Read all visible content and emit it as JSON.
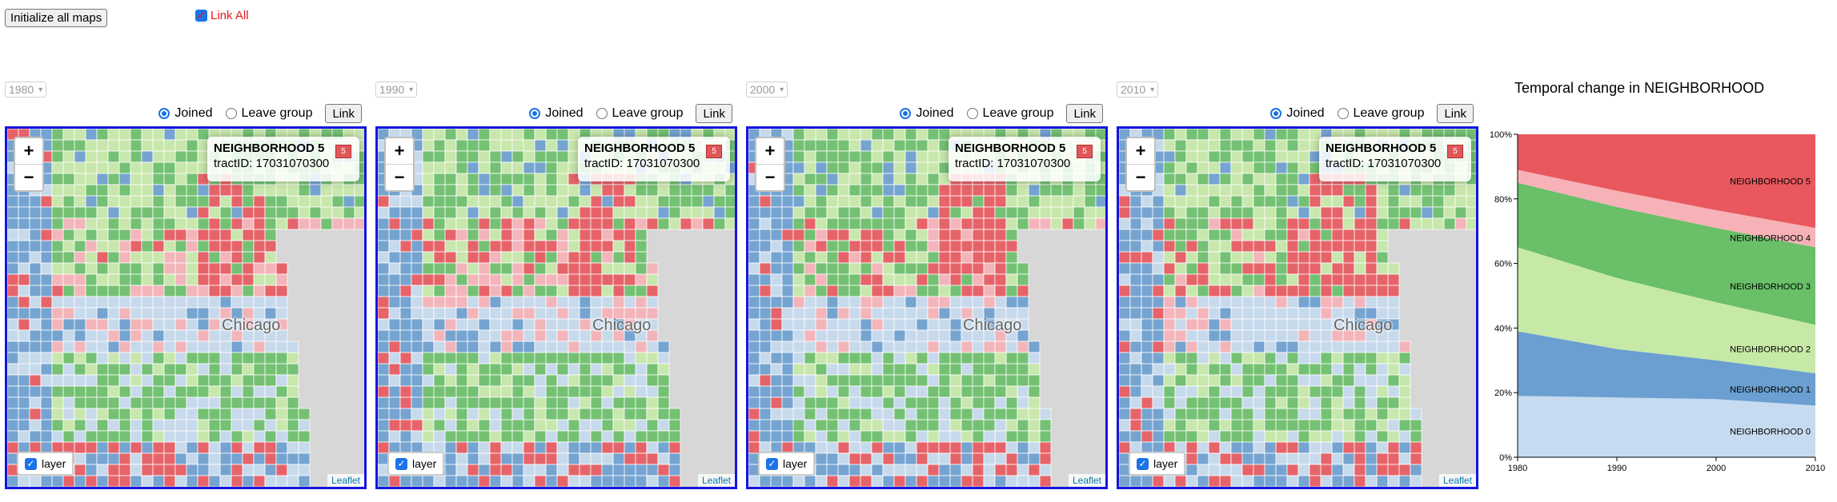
{
  "init_button": "Initialize all maps",
  "link_all": {
    "label": "Link All",
    "checked": true
  },
  "panels": [
    {
      "year": "1980",
      "joined": "Joined",
      "leave": "Leave group",
      "link": "Link",
      "info_name": "NEIGHBORHOOD 5",
      "info_badge": "5",
      "tract": "tractID: 17031070300",
      "layer": "layer",
      "attribution": "Leaflet",
      "city": "Chicago",
      "zoom_in": "+",
      "zoom_out": "−"
    },
    {
      "year": "1990",
      "joined": "Joined",
      "leave": "Leave group",
      "link": "Link",
      "info_name": "NEIGHBORHOOD 5",
      "info_badge": "5",
      "tract": "tractID: 17031070300",
      "layer": "layer",
      "attribution": "Leaflet",
      "city": "Chicago",
      "zoom_in": "+",
      "zoom_out": "−"
    },
    {
      "year": "2000",
      "joined": "Joined",
      "leave": "Leave group",
      "link": "Link",
      "info_name": "NEIGHBORHOOD 5",
      "info_badge": "5",
      "tract": "tractID: 17031070300",
      "layer": "layer",
      "attribution": "Leaflet",
      "city": "Chicago",
      "zoom_in": "+",
      "zoom_out": "−"
    },
    {
      "year": "2010",
      "joined": "Joined",
      "leave": "Leave group",
      "link": "Link",
      "info_name": "NEIGHBORHOOD 5",
      "info_badge": "5",
      "tract": "tractID: 17031070300",
      "layer": "layer",
      "attribution": "Leaflet",
      "city": "Chicago",
      "zoom_in": "+",
      "zoom_out": "−"
    }
  ],
  "colors": {
    "n0": "#c6dbef",
    "n1": "#6b9fd1",
    "n2": "#c7e9a8",
    "n3": "#6abf69",
    "n4": "#f7b2b7",
    "n5": "#e8585e",
    "map_border": "#1515e0",
    "link_all_text": "#e41a1c"
  },
  "chart_data": {
    "type": "area",
    "title": "Temporal change in NEIGHBORHOOD",
    "x": [
      1980,
      1990,
      2000,
      2010
    ],
    "x_tick_labels": [
      "1980",
      "1990",
      "2000",
      "2010"
    ],
    "y_tick_labels": [
      "0%",
      "20%",
      "40%",
      "60%",
      "80%",
      "100%"
    ],
    "ylim": [
      0,
      100
    ],
    "stacked": true,
    "series": [
      {
        "name": "NEIGHBORHOOD 0",
        "values": [
          19,
          18.5,
          18,
          16
        ],
        "color": "#c6dbef"
      },
      {
        "name": "NEIGHBORHOOD 1",
        "values": [
          20,
          15,
          12,
          10
        ],
        "color": "#6b9fd1"
      },
      {
        "name": "NEIGHBORHOOD 2",
        "values": [
          26,
          22,
          18,
          15
        ],
        "color": "#c7e9a8"
      },
      {
        "name": "NEIGHBORHOOD 3",
        "values": [
          20,
          22,
          23,
          24
        ],
        "color": "#6abf69"
      },
      {
        "name": "NEIGHBORHOOD 4",
        "values": [
          4,
          5,
          5.5,
          6
        ],
        "color": "#f7b2b7"
      },
      {
        "name": "NEIGHBORHOOD 5",
        "values": [
          11,
          17.5,
          23.5,
          29
        ],
        "color": "#e8585e"
      }
    ]
  }
}
